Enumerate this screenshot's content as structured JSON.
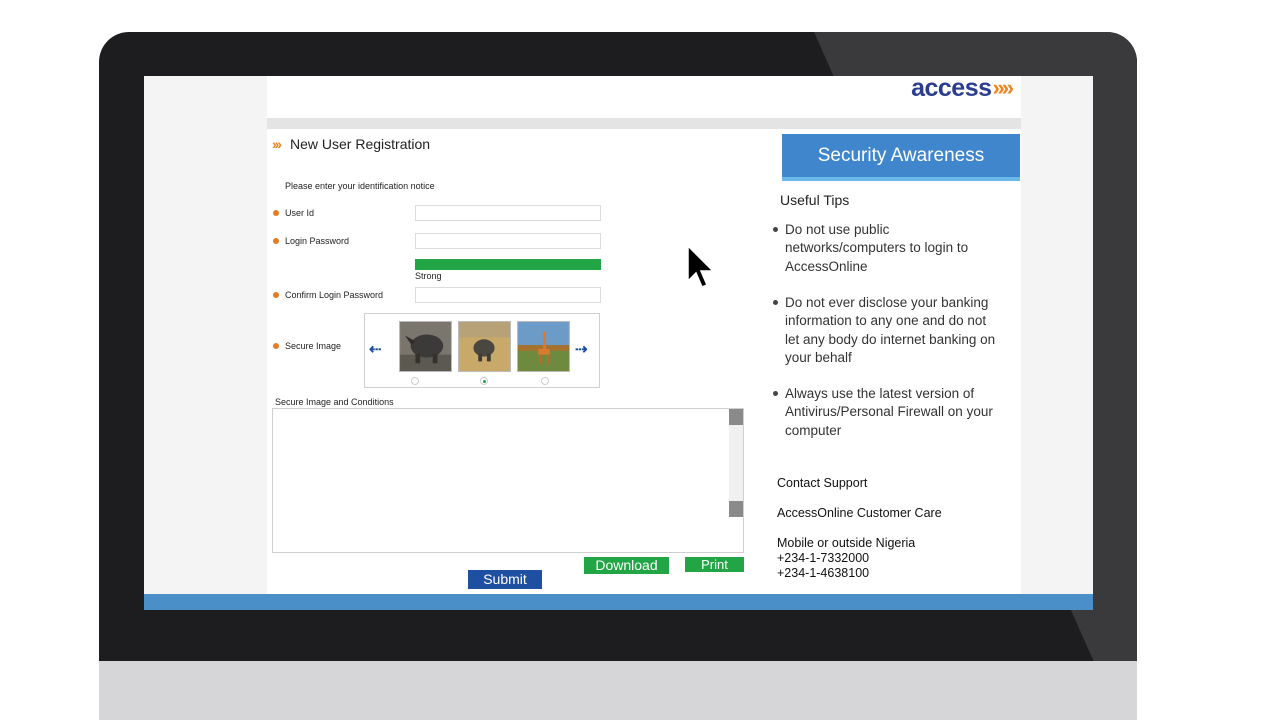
{
  "header": {
    "logo_text": "access",
    "logo_chevrons": "»»"
  },
  "form": {
    "title_chevrons": "›››",
    "title": "New User Registration",
    "notice": "Please enter your identification notice",
    "user_id_label": "User Id",
    "password_label": "Login Password",
    "strength_label": "Strong",
    "password_strength_fraction": 1.0,
    "confirm_label": "Confirm Login Password",
    "secure_image_label": "Secure Image",
    "secure_images": [
      "rhino-image",
      "rhino-grassland-image",
      "giraffe-image"
    ],
    "selected_image_index": 1,
    "conditions_label": "Secure Image and Conditions",
    "download_button": "Download",
    "print_button": "Print",
    "submit_button": "Submit"
  },
  "security": {
    "header": "Security Awareness",
    "tips_title": "Useful Tips",
    "tips": [
      "Do not use public networks/computers to login to AccessOnline",
      "Do not ever disclose your banking information to any one and do not let any body do internet banking on your behalf",
      "Always use the latest version of Antivirus/Personal Firewall on your computer"
    ],
    "contact_title": "Contact Support",
    "care_title": "AccessOnline Customer Care",
    "mobile_label": "Mobile or outside Nigeria",
    "phones": [
      "+234-1-7332000",
      "+234-1-4638100"
    ]
  },
  "colors": {
    "brand_blue": "#2b3d8f",
    "brand_orange": "#f0831e",
    "button_green": "#22a645",
    "button_blue": "#1f4fa0",
    "panel_blue": "#3f86cc"
  },
  "icons": {
    "prev_arrow": "arrow-left-icon",
    "next_arrow": "arrow-right-icon",
    "cursor": "mouse-pointer-icon"
  }
}
